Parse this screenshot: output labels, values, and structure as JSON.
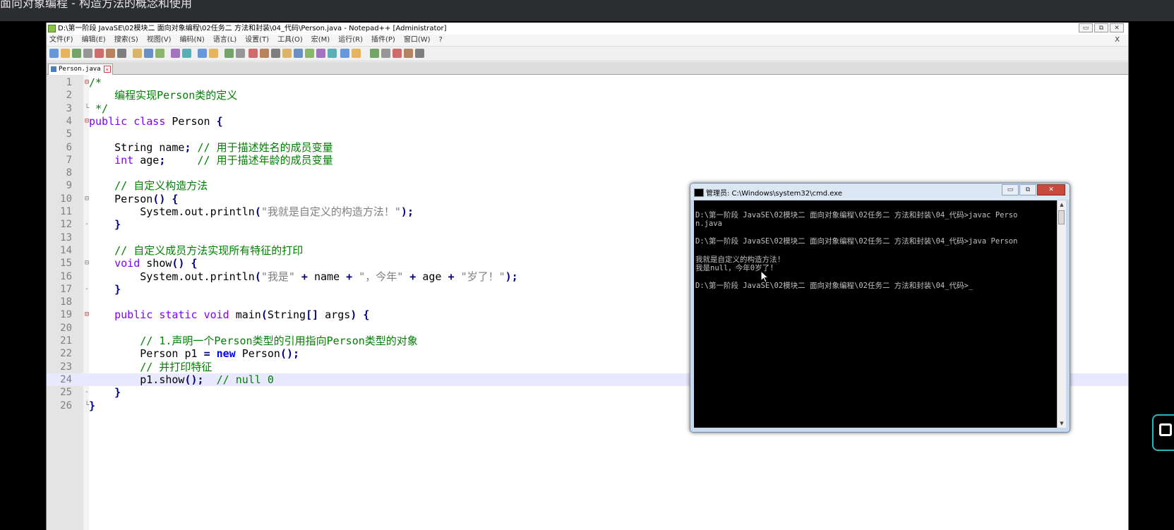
{
  "video_title": "面向对象编程 - 构造方法的概念和使用",
  "notepad": {
    "title": "D:\\第一阶段 JavaSE\\02模块二 面向对象编程\\02任务二 方法和封装\\04_代码\\Person.java - Notepad++ [Administrator]",
    "window_buttons": {
      "minimize": "▭",
      "restore": "⧉",
      "close": "✕"
    },
    "menu": [
      "文件(F)",
      "编辑(E)",
      "搜索(S)",
      "视图(V)",
      "编码(N)",
      "语言(L)",
      "设置(T)",
      "工具(O)",
      "宏(M)",
      "运行(R)",
      "插件(P)",
      "窗口(W)",
      "?"
    ],
    "menu_close": "X",
    "tab": {
      "label": "Person.java",
      "close": "×"
    },
    "current_line": 24,
    "lines": [
      {
        "n": "1",
        "fold": "⊟",
        "segs": [
          {
            "t": "/*",
            "c": "cm"
          }
        ]
      },
      {
        "n": "2",
        "fold": "",
        "segs": [
          {
            "t": "    编程实现Person类的定义",
            "c": "cm"
          }
        ]
      },
      {
        "n": "3",
        "fold": "└",
        "segs": [
          {
            "t": " */",
            "c": "cm"
          }
        ]
      },
      {
        "n": "4",
        "fold": "⊟",
        "segs": [
          {
            "t": "public",
            "c": "kw"
          },
          {
            "t": " ",
            "c": "pl"
          },
          {
            "t": "class",
            "c": "kw"
          },
          {
            "t": " Person ",
            "c": "pl"
          },
          {
            "t": "{",
            "c": "op"
          }
        ]
      },
      {
        "n": "5",
        "fold": "",
        "segs": []
      },
      {
        "n": "6",
        "fold": "",
        "segs": [
          {
            "t": "    String name",
            "c": "pl"
          },
          {
            "t": ";",
            "c": "op"
          },
          {
            "t": " // 用于描述姓名的成员变量",
            "c": "cm"
          }
        ]
      },
      {
        "n": "7",
        "fold": "",
        "segs": [
          {
            "t": "    ",
            "c": "pl"
          },
          {
            "t": "int",
            "c": "kw"
          },
          {
            "t": " age",
            "c": "pl"
          },
          {
            "t": ";",
            "c": "op"
          },
          {
            "t": "     // 用于描述年龄的成员变量",
            "c": "cm"
          }
        ]
      },
      {
        "n": "8",
        "fold": "",
        "segs": []
      },
      {
        "n": "9",
        "fold": "",
        "segs": [
          {
            "t": "    // 自定义构造方法",
            "c": "cm"
          }
        ]
      },
      {
        "n": "10",
        "fold": "⊟",
        "segs": [
          {
            "t": "    Person",
            "c": "pl"
          },
          {
            "t": "() {",
            "c": "op"
          }
        ]
      },
      {
        "n": "11",
        "fold": "",
        "segs": [
          {
            "t": "        System.out.println",
            "c": "pl"
          },
          {
            "t": "(",
            "c": "op"
          },
          {
            "t": "\"我就是自定义的构造方法！\"",
            "c": "str"
          },
          {
            "t": ");",
            "c": "op"
          }
        ]
      },
      {
        "n": "12",
        "fold": "-",
        "segs": [
          {
            "t": "    ",
            "c": "pl"
          },
          {
            "t": "}",
            "c": "op"
          }
        ]
      },
      {
        "n": "13",
        "fold": "",
        "segs": []
      },
      {
        "n": "14",
        "fold": "",
        "segs": [
          {
            "t": "    // 自定义成员方法实现所有特征的打印",
            "c": "cm"
          }
        ]
      },
      {
        "n": "15",
        "fold": "⊟",
        "segs": [
          {
            "t": "    ",
            "c": "pl"
          },
          {
            "t": "void",
            "c": "kw"
          },
          {
            "t": " show",
            "c": "pl"
          },
          {
            "t": "() {",
            "c": "op"
          }
        ]
      },
      {
        "n": "16",
        "fold": "",
        "segs": [
          {
            "t": "        System.out.println",
            "c": "pl"
          },
          {
            "t": "(",
            "c": "op"
          },
          {
            "t": "\"我是\"",
            "c": "str"
          },
          {
            "t": " + ",
            "c": "op"
          },
          {
            "t": "name",
            "c": "pl"
          },
          {
            "t": " + ",
            "c": "op"
          },
          {
            "t": "\"，今年\"",
            "c": "str"
          },
          {
            "t": " + ",
            "c": "op"
          },
          {
            "t": "age",
            "c": "pl"
          },
          {
            "t": " + ",
            "c": "op"
          },
          {
            "t": "\"岁了！\"",
            "c": "str"
          },
          {
            "t": ");",
            "c": "op"
          }
        ]
      },
      {
        "n": "17",
        "fold": "-",
        "segs": [
          {
            "t": "    ",
            "c": "pl"
          },
          {
            "t": "}",
            "c": "op"
          }
        ]
      },
      {
        "n": "18",
        "fold": "",
        "segs": []
      },
      {
        "n": "19",
        "fold": "⊟",
        "segs": [
          {
            "t": "    ",
            "c": "pl"
          },
          {
            "t": "public",
            "c": "kw"
          },
          {
            "t": " ",
            "c": "pl"
          },
          {
            "t": "static",
            "c": "kw"
          },
          {
            "t": " ",
            "c": "pl"
          },
          {
            "t": "void",
            "c": "kw"
          },
          {
            "t": " main",
            "c": "pl"
          },
          {
            "t": "(",
            "c": "op"
          },
          {
            "t": "String",
            "c": "pl"
          },
          {
            "t": "[]",
            "c": "op"
          },
          {
            "t": " args",
            "c": "pl"
          },
          {
            "t": ") {",
            "c": "op"
          }
        ]
      },
      {
        "n": "20",
        "fold": "",
        "segs": []
      },
      {
        "n": "21",
        "fold": "",
        "segs": [
          {
            "t": "        // 1.声明一个Person类型的引用指向Person类型的对象",
            "c": "cm"
          }
        ]
      },
      {
        "n": "22",
        "fold": "",
        "segs": [
          {
            "t": "        Person p1 ",
            "c": "pl"
          },
          {
            "t": "=",
            "c": "op"
          },
          {
            "t": " ",
            "c": "pl"
          },
          {
            "t": "new",
            "c": "kw2"
          },
          {
            "t": " Person",
            "c": "pl"
          },
          {
            "t": "();",
            "c": "op"
          }
        ]
      },
      {
        "n": "23",
        "fold": "",
        "segs": [
          {
            "t": "        // 并打印特征",
            "c": "cm"
          }
        ]
      },
      {
        "n": "24",
        "fold": "",
        "segs": [
          {
            "t": "        p1.show",
            "c": "pl"
          },
          {
            "t": "();",
            "c": "op"
          },
          {
            "t": "  // null 0",
            "c": "cm"
          }
        ]
      },
      {
        "n": "25",
        "fold": "-",
        "segs": [
          {
            "t": "    ",
            "c": "pl"
          },
          {
            "t": "}",
            "c": "op"
          }
        ]
      },
      {
        "n": "26",
        "fold": "└",
        "segs": [
          {
            "t": "}",
            "c": "op"
          }
        ]
      }
    ]
  },
  "cmd": {
    "title": "管理员: C:\\Windows\\system32\\cmd.exe",
    "buttons": {
      "minimize": "▭",
      "restore": "⧉",
      "close": "✕"
    },
    "lines": [
      "",
      "D:\\第一阶段 JavaSE\\02模块二 面向对象编程\\02任务二 方法和封装\\04_代码>javac Perso",
      "n.java",
      "",
      "D:\\第一阶段 JavaSE\\02模块二 面向对象编程\\02任务二 方法和封装\\04_代码>java Person",
      "",
      "我就是自定义的构造方法!",
      "我是null，今年0岁了!",
      "",
      "D:\\第一阶段 JavaSE\\02模块二 面向对象编程\\02任务二 方法和封装\\04_代码>_"
    ]
  },
  "toolbar_icons": [
    "new-icon",
    "open-icon",
    "save-icon",
    "save-all-icon",
    "close-icon",
    "close-all-icon",
    "print-icon",
    "cut-icon",
    "copy-icon",
    "paste-icon",
    "undo-icon",
    "redo-icon",
    "find-icon",
    "replace-icon",
    "zoom-in-icon",
    "zoom-out-icon",
    "sync-v-icon",
    "sync-h-icon",
    "wrap-icon",
    "all-chars-icon",
    "indent-guide-icon",
    "udl-icon",
    "doc-map-icon",
    "function-list-icon",
    "folder-icon",
    "monitor-icon",
    "record-icon",
    "stop-icon",
    "play-icon",
    "play-multi-icon",
    "save-macro-icon"
  ]
}
